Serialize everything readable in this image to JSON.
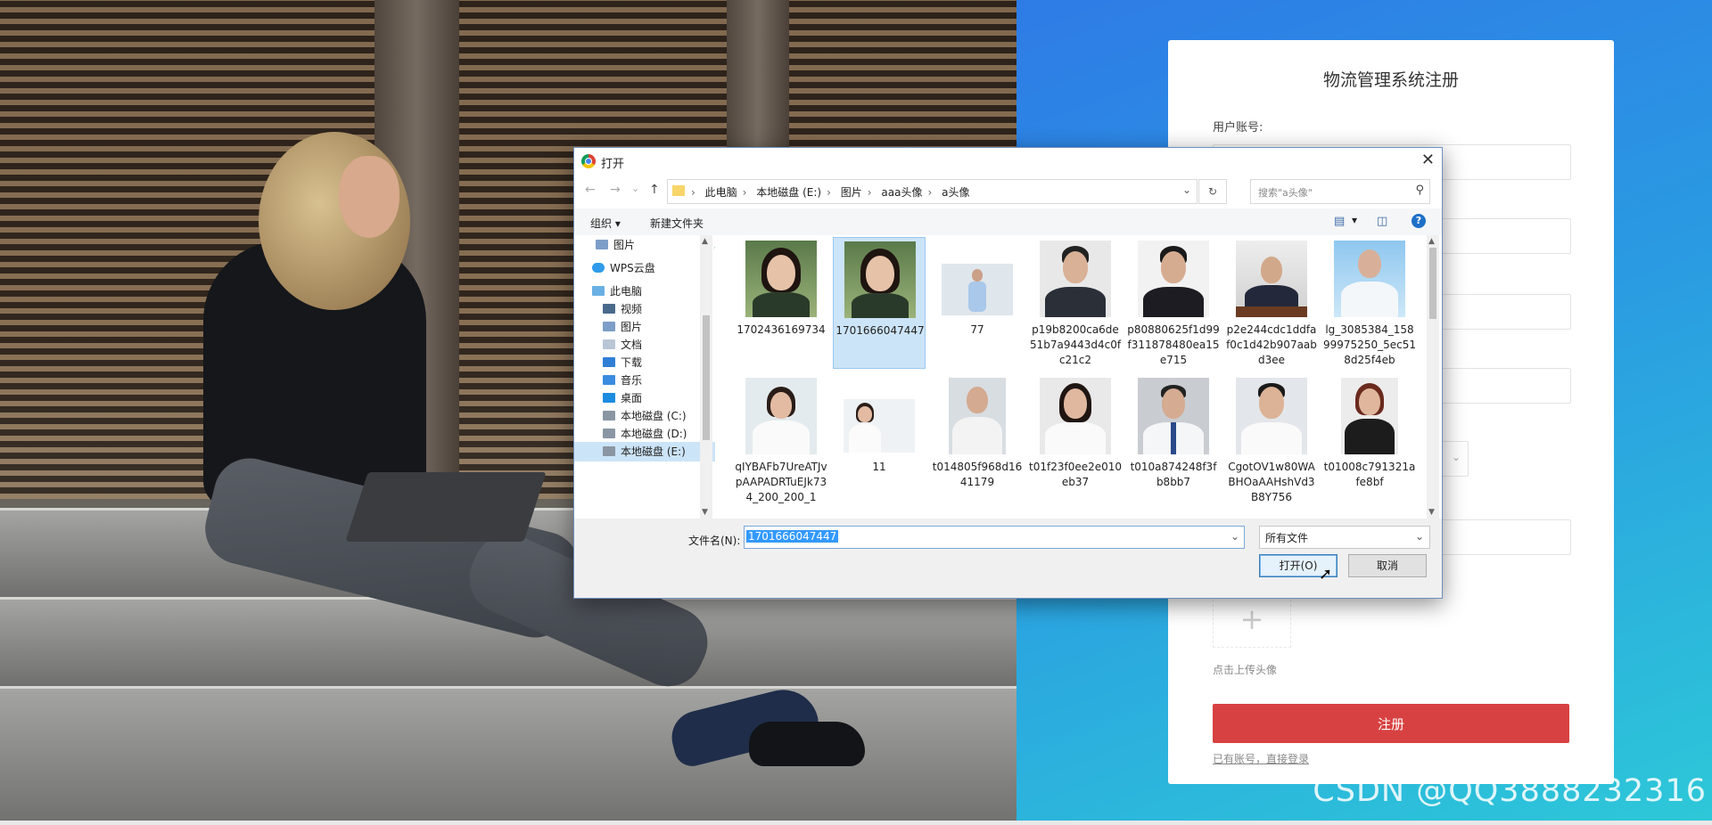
{
  "register": {
    "title": "物流管理系统注册",
    "account_label": "用户账号:",
    "upload_plus": "+",
    "upload_hint": "点击上传头像",
    "register_button": "注册",
    "login_link": "已有账号，直接登录"
  },
  "watermark": "CSDN @QQ3888232316",
  "dialog": {
    "title": "打开",
    "close": "✕",
    "nav": {
      "back": "←",
      "forward": "→",
      "recent": "⌄",
      "up": "↑"
    },
    "breadcrumb": [
      "此电脑",
      "本地磁盘 (E:)",
      "图片",
      "aaa头像",
      "a头像"
    ],
    "addr_dropdown": "⌄",
    "refresh": "↻",
    "search_placeholder": "搜索\"a头像\"",
    "toolbar": {
      "organize": "组织 ▾",
      "new_folder": "新建文件夹",
      "view_menu": "▾",
      "help": "?"
    },
    "sidebar": [
      {
        "label": "图片",
        "icon": "pictures-icon",
        "pinned": true
      },
      {
        "label": "WPS云盘",
        "icon": "cloud-icon"
      },
      {
        "label": "此电脑",
        "icon": "computer-icon"
      },
      {
        "label": "视频",
        "icon": "videos-icon"
      },
      {
        "label": "图片",
        "icon": "pictures-icon"
      },
      {
        "label": "文档",
        "icon": "documents-icon"
      },
      {
        "label": "下载",
        "icon": "downloads-icon"
      },
      {
        "label": "音乐",
        "icon": "music-icon"
      },
      {
        "label": "桌面",
        "icon": "desktop-icon"
      },
      {
        "label": "本地磁盘 (C:)",
        "icon": "drive-icon"
      },
      {
        "label": "本地磁盘 (D:)",
        "icon": "drive-icon"
      },
      {
        "label": "本地磁盘 (E:)",
        "icon": "drive-icon",
        "selected": true
      }
    ],
    "files": [
      {
        "name": "1702436169734"
      },
      {
        "name": "1701666047447",
        "selected": true
      },
      {
        "name": "77"
      },
      {
        "name": "p19b8200ca6de51b7a9443d4c0fc21c2"
      },
      {
        "name": "p80880625f1d99f311878480ea15e715"
      },
      {
        "name": "p2e244cdc1ddfaf0c1d42b907aabd3ee"
      },
      {
        "name": "lg_3085384_15899975250_5ec518d25f4eb"
      },
      {
        "name": "qIYBAFb7UreATJvpAAPADRTuEJk734_200_200_1"
      },
      {
        "name": "11"
      },
      {
        "name": "t014805f968d1641179"
      },
      {
        "name": "t01f23f0ee2e010eb37"
      },
      {
        "name": "t010a874248f3fb8bb7"
      },
      {
        "name": "CgotOV1w80WABHOaAAHshVd3B8Y756"
      },
      {
        "name": "t01008c791321afe8bf"
      }
    ],
    "filename_label": "文件名(N):",
    "filename_value": "1701666047447",
    "filetype_value": "所有文件",
    "dropdown_glyph": "⌄",
    "open_button": "打开(O)",
    "cancel_button": "取消"
  },
  "colors": {
    "accent": "#d84141",
    "selection": "#cce4f7",
    "gradient_start": "#2e7be6",
    "gradient_end": "#2dc8d8"
  }
}
